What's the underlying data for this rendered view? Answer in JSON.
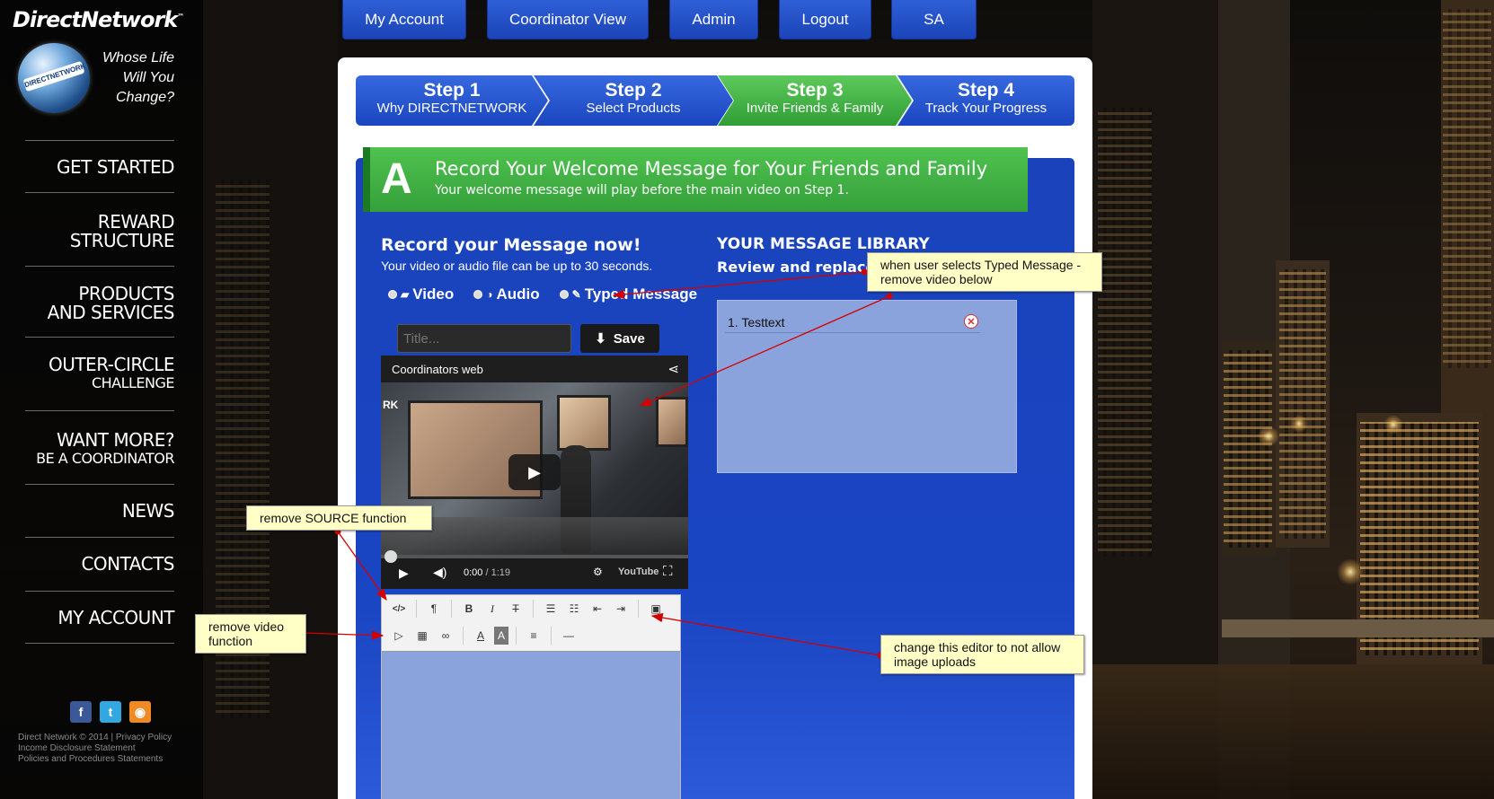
{
  "brand": {
    "name": "DirectNetwork",
    "tm": "™",
    "globe_label": "DIRECTNETWORK",
    "tagline": [
      "Whose Life",
      "Will You",
      "Change?"
    ]
  },
  "sidebar": {
    "items": [
      {
        "line1": "GET STARTED",
        "line2": ""
      },
      {
        "line1": "REWARD",
        "line2": "STRUCTURE"
      },
      {
        "line1": "PRODUCTS",
        "line2": "AND SERVICES"
      },
      {
        "line1": "OUTER-CIRCLE",
        "line2": "CHALLENGE"
      },
      {
        "line1": "WANT MORE?",
        "line2": "BE A COORDINATOR"
      },
      {
        "line1": "NEWS",
        "line2": ""
      },
      {
        "line1": "CONTACTS",
        "line2": ""
      },
      {
        "line1": "MY ACCOUNT",
        "line2": ""
      }
    ],
    "social": [
      {
        "icon": "facebook-icon",
        "glyph": "f",
        "color": "#3b5998"
      },
      {
        "icon": "twitter-icon",
        "glyph": "t",
        "color": "#33a7e0"
      },
      {
        "icon": "rss-icon",
        "glyph": "◉",
        "color": "#f08a24"
      }
    ],
    "footer": [
      "Direct Network © 2014 | Privacy Policy",
      "Income Disclosure Statement",
      "Policies and Procedures Statements"
    ]
  },
  "topnav": [
    "My Account",
    "Coordinator View",
    "Admin",
    "Logout",
    "SA"
  ],
  "steps": [
    {
      "title": "Step 1",
      "sub": "Why DIRECTNETWORK"
    },
    {
      "title": "Step 2",
      "sub": "Select Products"
    },
    {
      "title": "Step 3",
      "sub": "Invite Friends & Family",
      "active": true
    },
    {
      "title": "Step 4",
      "sub": "Track Your Progress"
    }
  ],
  "banner": {
    "letter": "A",
    "heading": "Record Your Welcome Message for Your Friends and Family",
    "sub": "Your welcome message will play before the main video on Step 1."
  },
  "record": {
    "heading": "Record your Message now!",
    "sub": "Your video or audio file can be up to 30 seconds.",
    "options": [
      "Video",
      "Audio",
      "Typed Message"
    ],
    "title_placeholder": "Title...",
    "save_label": "Save"
  },
  "video": {
    "title": "Coordinators web",
    "overlay_text": "RK",
    "time_current": "0:00",
    "time_total": "/ 1:19",
    "brand": "YouTube"
  },
  "library": {
    "heading": "YOUR MESSAGE LIBRARY",
    "sub": "Review and replace yo",
    "items": [
      "1. Testtext"
    ]
  },
  "annotations": {
    "typed": "when user selects Typed Message - remove video below",
    "source": "remove SOURCE function",
    "video_fn": "remove video function",
    "image": "change this editor to not allow image uploads"
  }
}
